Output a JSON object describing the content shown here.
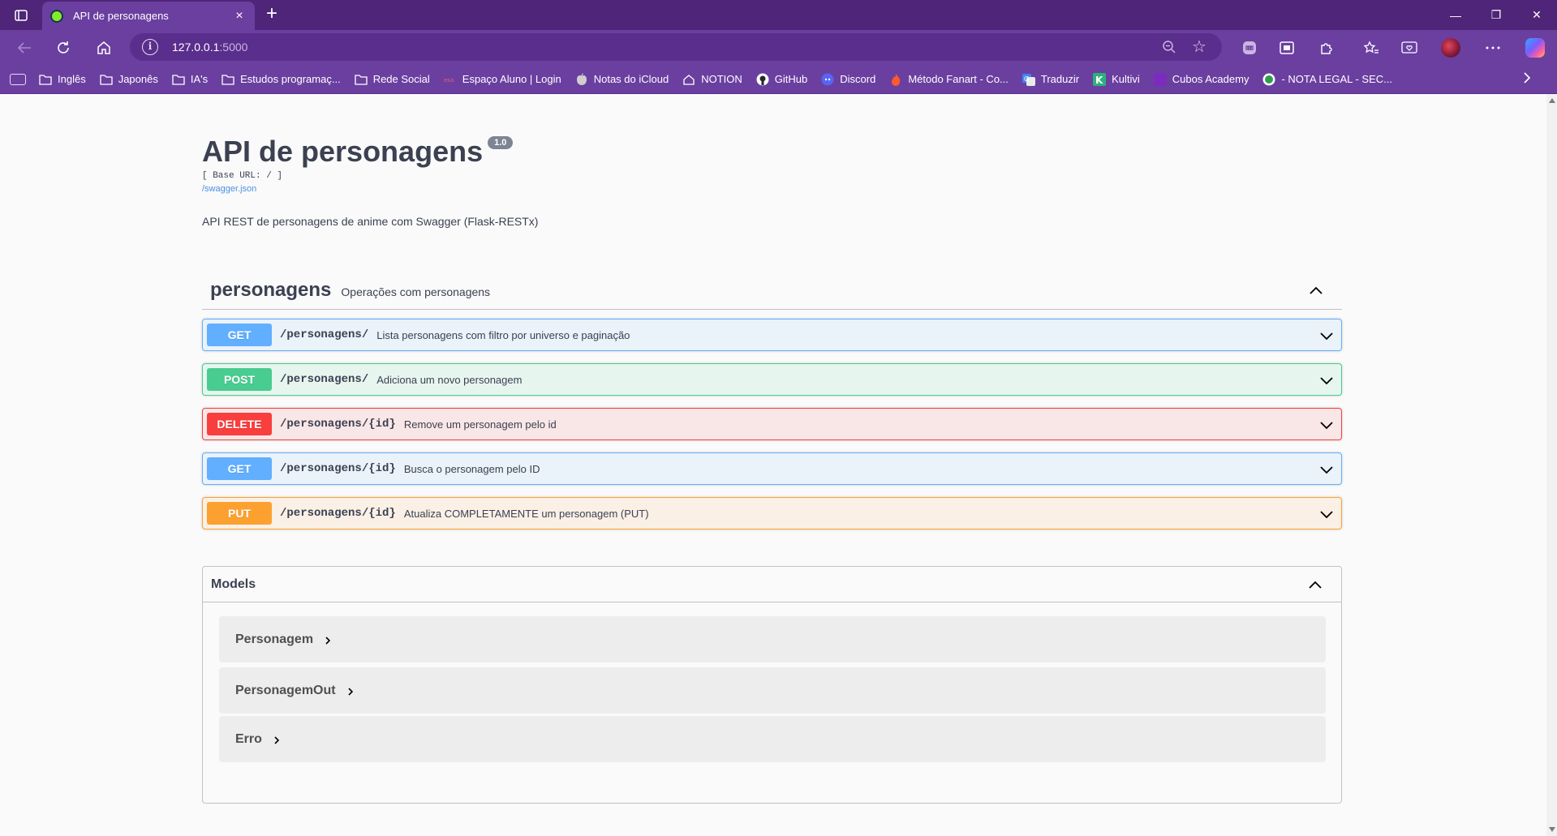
{
  "browser": {
    "tab_title": "API de personagens",
    "tab_close": "×",
    "new_tab": "+",
    "url_host": "127.0.0.1",
    "url_port": ":5000",
    "info_glyph": "i",
    "star_glyph": "☆",
    "window": {
      "minimize": "—",
      "restore": "❐",
      "close": "✕"
    },
    "accent": "#6b3fa0"
  },
  "bookmarks": [
    {
      "label": "Inglês",
      "icon": "folder-icon"
    },
    {
      "label": "Japonês",
      "icon": "folder-icon"
    },
    {
      "label": "IA's",
      "icon": "folder-icon"
    },
    {
      "label": "Estudos programaç...",
      "icon": "folder-icon"
    },
    {
      "label": "Rede Social",
      "icon": "folder-icon"
    },
    {
      "label": "Espaço Aluno | Login",
      "icon": "school-icon"
    },
    {
      "label": "Notas do iCloud",
      "icon": "apple-icon"
    },
    {
      "label": "NOTION",
      "icon": "home-icon"
    },
    {
      "label": "GitHub",
      "icon": "github-icon"
    },
    {
      "label": "Discord",
      "icon": "discord-icon"
    },
    {
      "label": "Método Fanart - Co...",
      "icon": "flame-icon"
    },
    {
      "label": "Traduzir",
      "icon": "translate-icon"
    },
    {
      "label": "Kultivi",
      "icon": "kultivi-icon"
    },
    {
      "label": "Cubos Academy",
      "icon": "cubos-icon"
    },
    {
      "label": "- NOTA LEGAL - SEC...",
      "icon": "notalegal-icon"
    }
  ],
  "info": {
    "title": "API de personagens",
    "version": "1.0",
    "base_url": "[ Base URL: / ]",
    "spec_link": "/swagger.json",
    "description": "API REST de personagens de anime com Swagger (Flask-RESTx)"
  },
  "tag": {
    "name": "personagens",
    "description": "Operações com personagens"
  },
  "operations": [
    {
      "method": "GET",
      "path": "/personagens/",
      "summary": "Lista personagens com filtro por universo e paginação",
      "color": "#61affe"
    },
    {
      "method": "POST",
      "path": "/personagens/",
      "summary": "Adiciona um novo personagem",
      "color": "#49cc90"
    },
    {
      "method": "DELETE",
      "path": "/personagens/{id}",
      "summary": "Remove um personagem pelo id",
      "color": "#f93e3e"
    },
    {
      "method": "GET",
      "path": "/personagens/{id}",
      "summary": "Busca o personagem pelo ID",
      "color": "#61affe"
    },
    {
      "method": "PUT",
      "path": "/personagens/{id}",
      "summary": "Atualiza COMPLETAMENTE um personagem (PUT)",
      "color": "#fca130"
    }
  ],
  "models": {
    "title": "Models",
    "items": [
      {
        "name": "Personagem"
      },
      {
        "name": "PersonagemOut"
      },
      {
        "name": "Erro"
      }
    ]
  }
}
